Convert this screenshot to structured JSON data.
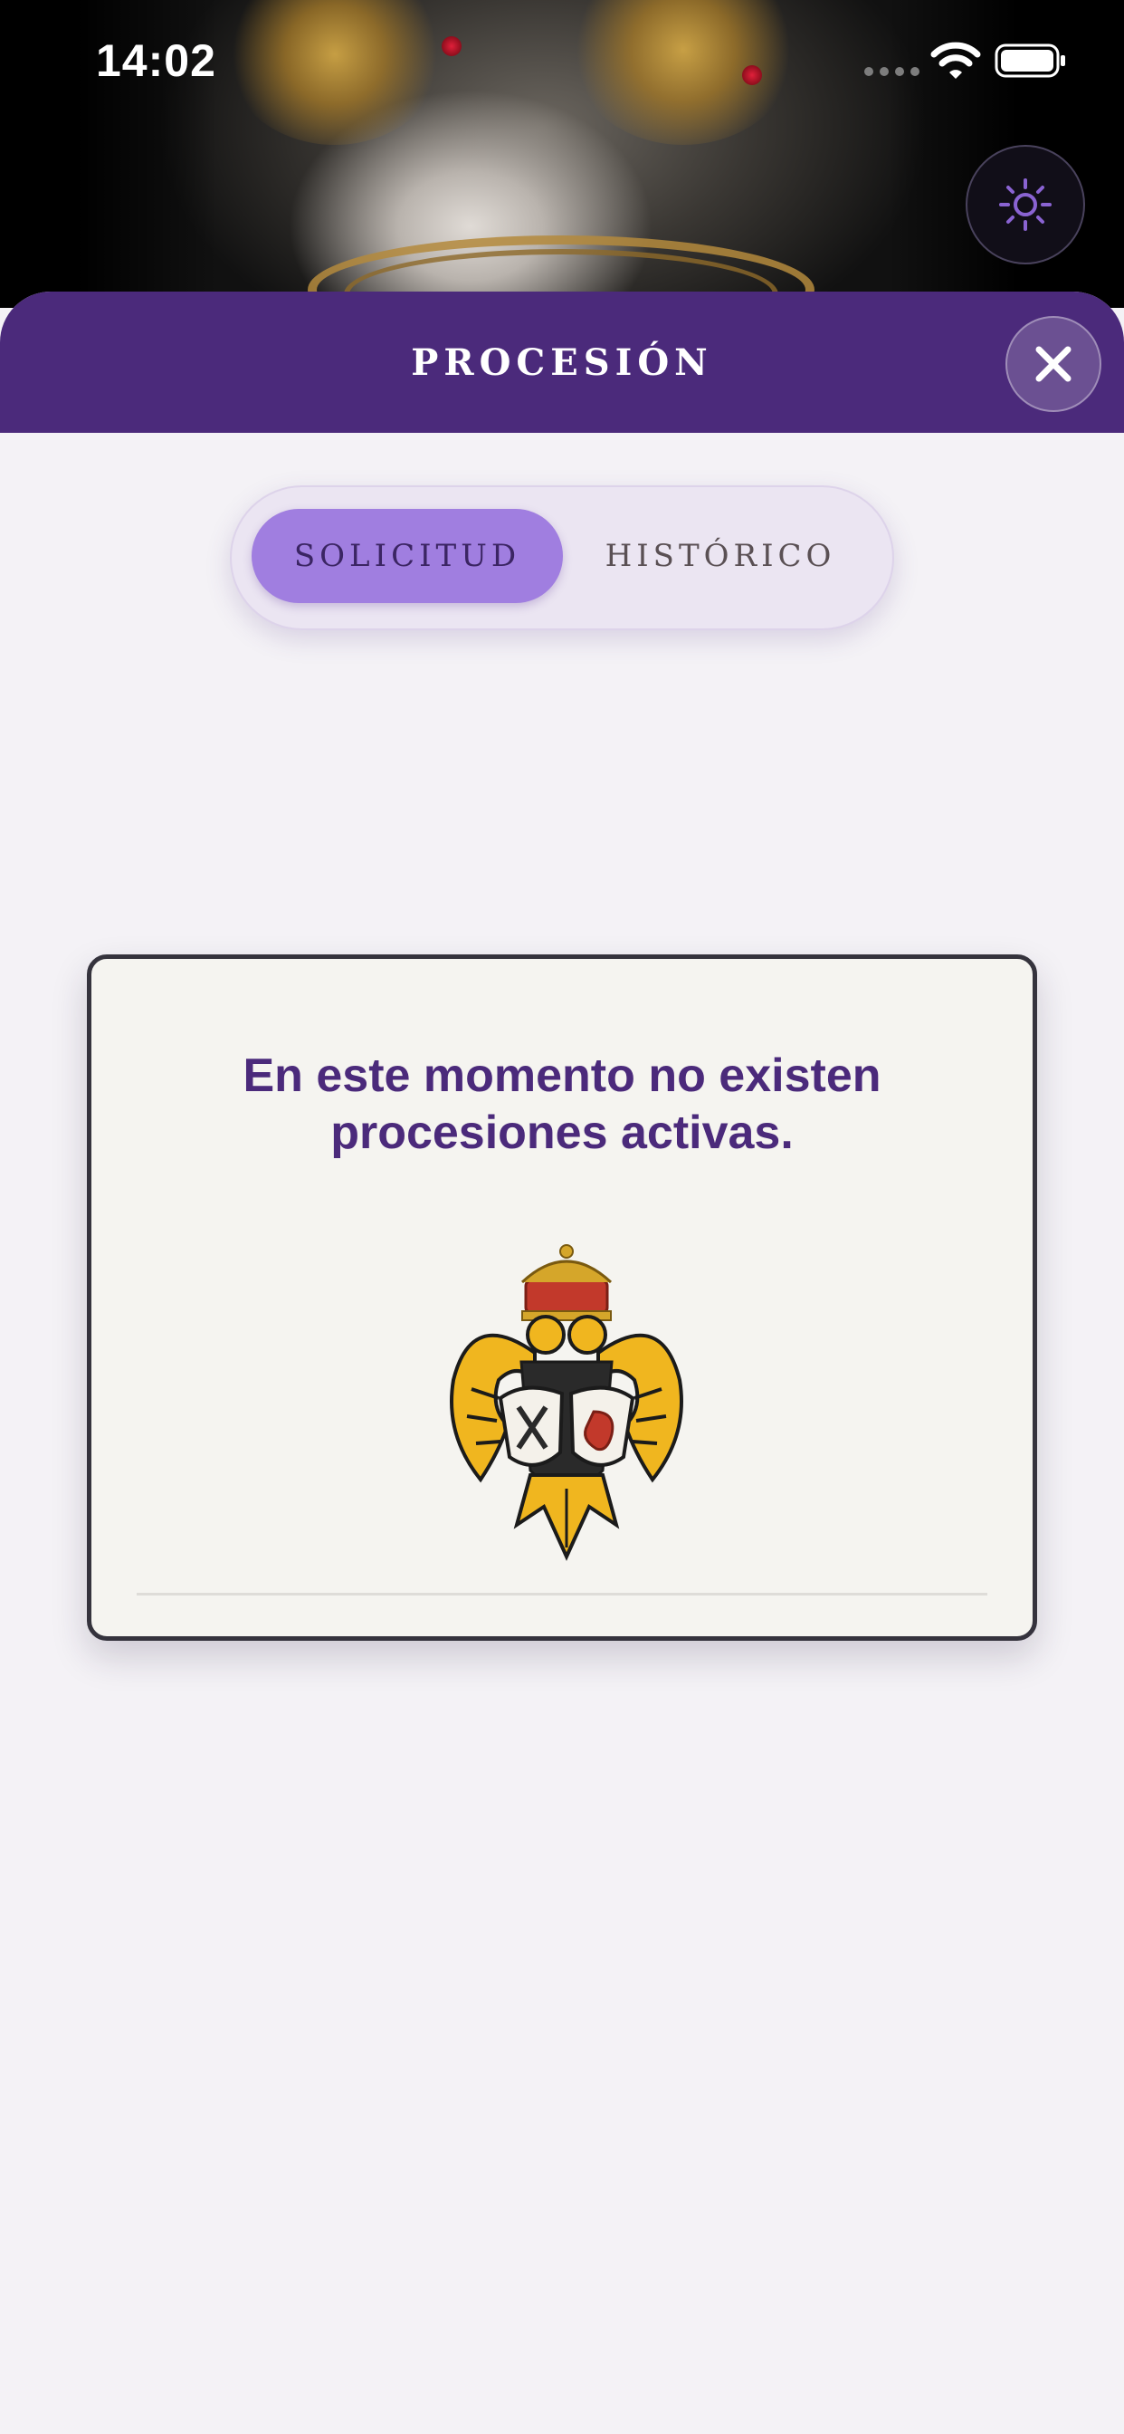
{
  "status_bar": {
    "time": "14:02"
  },
  "header": {
    "title": "PROCESIÓN"
  },
  "tabs": [
    {
      "label": "SOLICITUD",
      "selected": true
    },
    {
      "label": "HISTÓRICO",
      "selected": false
    }
  ],
  "empty_state": {
    "message": "En este momento no existen procesiones activas."
  },
  "icons": {
    "theme_toggle": "sun-icon",
    "close": "close-icon",
    "crest": "coat-of-arms-image"
  },
  "colors": {
    "brand_purple": "#4b2a7b",
    "active_tab": "#a07ee0",
    "background": "#f4f2f6"
  }
}
